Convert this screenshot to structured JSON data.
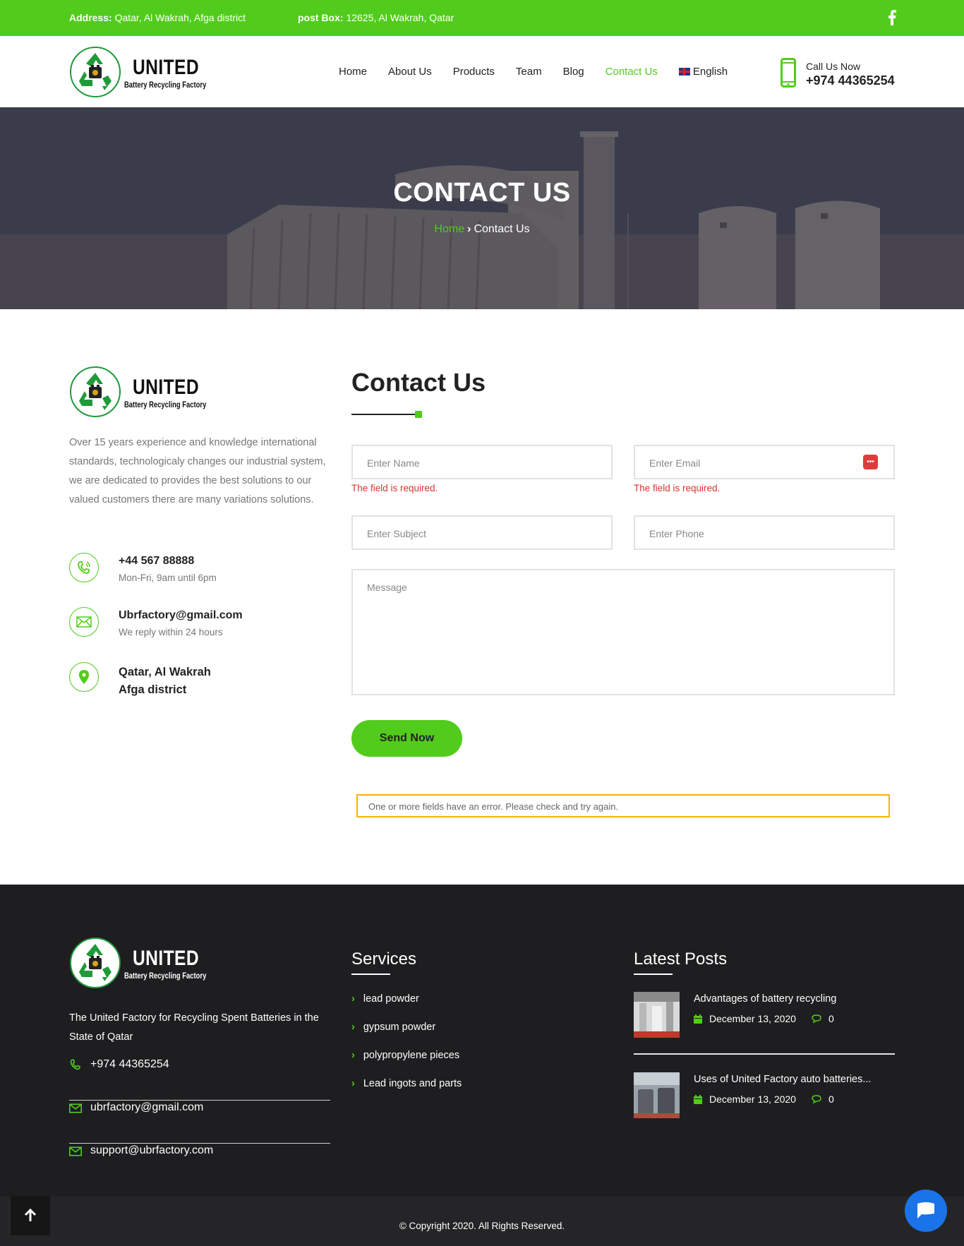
{
  "topbar": {
    "address_label": "Address:",
    "address_value": "Qatar, Al Wakrah, Afga district",
    "pobox_label": "post Box:",
    "pobox_value": "12625, Al Wakrah, Qatar"
  },
  "logo": {
    "brand": "UNITED",
    "sub": "Battery Recycling Factory"
  },
  "nav": {
    "items": [
      {
        "label": "Home"
      },
      {
        "label": "About Us"
      },
      {
        "label": "Products"
      },
      {
        "label": "Team"
      },
      {
        "label": "Blog"
      },
      {
        "label": "Contact Us",
        "active": true
      },
      {
        "label": "English"
      }
    ]
  },
  "call": {
    "label": "Call Us Now",
    "number": "+974 44365254"
  },
  "hero": {
    "title": "CONTACT US",
    "crumb_home": "Home",
    "crumb_current": "Contact Us"
  },
  "about": {
    "text": "Over 15 years experience and knowledge international standards, technologicaly changes our industrial system, we are dedicated to provides the best solutions to our valued customers there are many variations solutions."
  },
  "contact_info": {
    "phone": "+44 567 88888",
    "phone_note": "Mon-Fri, 9am until 6pm",
    "email": "Ubrfactory@gmail.com",
    "email_note": "We reply within 24 hours",
    "address_line1": "Qatar, Al Wakrah",
    "address_line2": "Afga district"
  },
  "form": {
    "title": "Contact Us",
    "name_placeholder": "Enter Name",
    "email_placeholder": "Enter Email",
    "subject_placeholder": "Enter Subject",
    "phone_placeholder": "Enter Phone",
    "message_placeholder": "Message",
    "error_required": "The field is required.",
    "submit_label": "Send Now",
    "notice": "One or more fields have an error. Please check and try again."
  },
  "footer": {
    "description": "The United Factory for Recycling Spent Batteries in the State of Qatar",
    "phone": "+974 44365254",
    "email1": "ubrfactory@gmail.com",
    "email2": "support@ubrfactory.com",
    "services_title": "Services",
    "services": [
      "lead powder",
      "gypsum powder",
      "polypropylene pieces",
      "Lead ingots and parts"
    ],
    "posts_title": "Latest Posts",
    "posts": [
      {
        "title": "Advantages of battery recycling",
        "date": "December 13, 2020",
        "comments": "0"
      },
      {
        "title": "Uses of United Factory auto batteries...",
        "date": "December 13, 2020",
        "comments": "0"
      }
    ],
    "copyright": "© Copyright 2020. All Rights Reserved."
  },
  "colors": {
    "accent": "#52cc1c",
    "footer_bg": "#1e1e20",
    "error": "#dc3232",
    "notice_border": "#f8b600"
  },
  "icons": [
    "facebook-icon",
    "mobile-phone-icon",
    "phone-ring-icon",
    "envelope-icon",
    "location-pin-icon",
    "calendar-icon",
    "comment-icon",
    "arrow-up-icon",
    "chat-icon",
    "recycle-logo-icon"
  ]
}
